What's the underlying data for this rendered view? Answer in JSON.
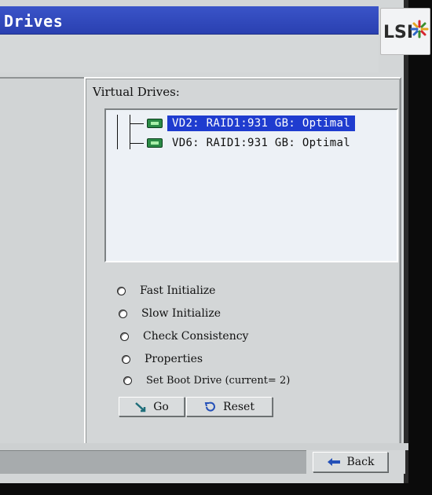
{
  "titlebar": {
    "title": "Drives"
  },
  "logo": {
    "text": "LSI",
    "icon": "lsi-starburst-logo"
  },
  "virtual_drives": {
    "label": "Virtual Drives:",
    "items": [
      {
        "text": "VD2: RAID1:931 GB: Optimal",
        "selected": true
      },
      {
        "text": "VD6: RAID1:931 GB: Optimal",
        "selected": false
      }
    ]
  },
  "options": [
    {
      "label": "Fast Initialize",
      "selected": false
    },
    {
      "label": "Slow Initialize",
      "selected": false
    },
    {
      "label": "Check Consistency",
      "selected": false
    },
    {
      "label": "Properties",
      "selected": false
    },
    {
      "label": "Set Boot Drive (current= 2)",
      "selected": false
    }
  ],
  "buttons": {
    "go": {
      "label": "Go",
      "icon": "go-arrow-icon"
    },
    "reset": {
      "label": "Reset",
      "icon": "reset-icon"
    },
    "back": {
      "label": "Back",
      "icon": "back-arrow-icon"
    }
  },
  "colors": {
    "titlebar": "#2a40b1",
    "selection": "#1f3ccf",
    "drive_icon": "#2b8a46",
    "panel": "#d3d6d7"
  }
}
